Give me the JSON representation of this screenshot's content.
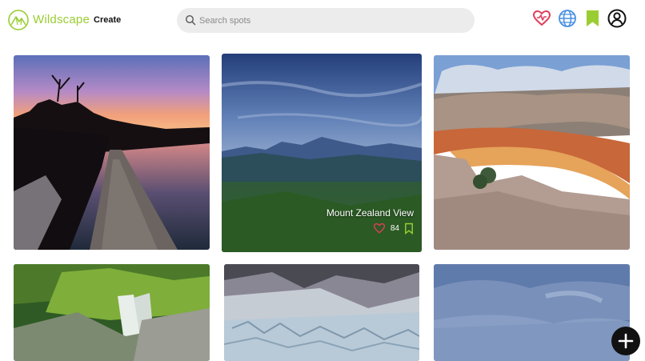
{
  "header": {
    "brand": "Wildscape",
    "create_label": "Create",
    "search_placeholder": "Search spots",
    "icons": [
      "heart-icon",
      "globe-icon",
      "bookmark-icon",
      "account-icon"
    ]
  },
  "colors": {
    "brand": "#9acd32",
    "heart": "#e03e5c",
    "globe": "#4a90e2",
    "bookmark": "#9acd32"
  },
  "feed": {
    "featured": {
      "title": "Mount Zealand View",
      "likes": "84"
    }
  }
}
